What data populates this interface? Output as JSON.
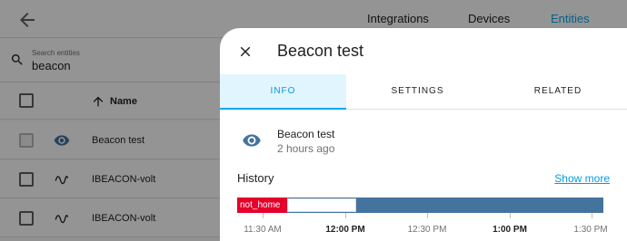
{
  "top_tabs": [
    "Integrations",
    "Devices",
    "Entities"
  ],
  "search": {
    "label": "Search entities",
    "value": "beacon"
  },
  "table": {
    "header_name": "Name",
    "rows": [
      {
        "name": "Beacon test",
        "icon": "eye-icon"
      },
      {
        "name": "IBEACON-volt",
        "icon": "sine-wave-icon"
      },
      {
        "name": "IBEACON-volt",
        "icon": "sine-wave-icon"
      }
    ]
  },
  "dialog": {
    "title": "Beacon test",
    "tabs": [
      "INFO",
      "SETTINGS",
      "RELATED"
    ],
    "active_tab": "INFO",
    "entity": {
      "name": "Beacon test",
      "last_changed": "2 hours ago",
      "icon": "eye-icon"
    },
    "history": {
      "title": "History",
      "show_more": "Show more",
      "state_label": "not_home",
      "time_labels": [
        "11:30 AM",
        "12:00 PM",
        "12:30 PM",
        "1:00 PM",
        "1:30 PM"
      ]
    }
  },
  "colors": {
    "accent": "#03a9f4",
    "state_blue": "#44739e",
    "state_red": "#e4002b"
  }
}
